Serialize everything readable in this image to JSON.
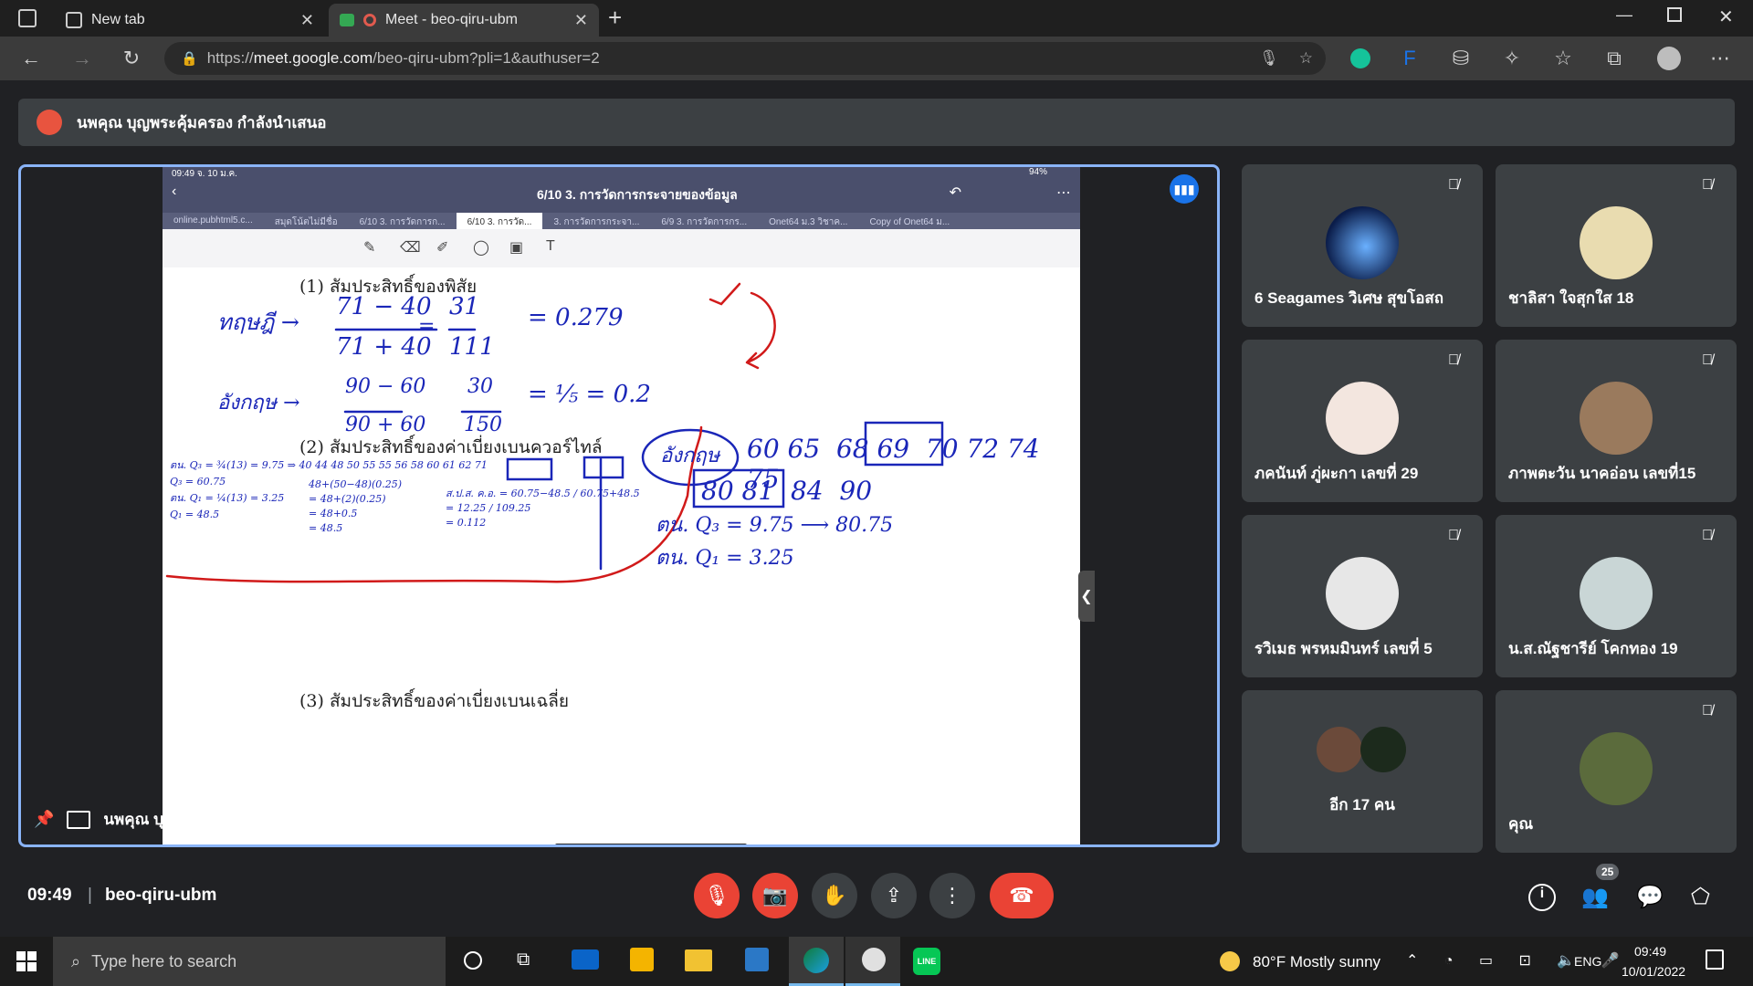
{
  "browser": {
    "tabs": [
      {
        "label": "New tab"
      },
      {
        "label": "Meet - beo-qiru-ubm"
      }
    ],
    "url_prefix": "https://",
    "url_host": "meet.google.com",
    "url_path": "/beo-qiru-ubm?pli=1&authuser=2"
  },
  "meet": {
    "banner": "นพคุณ บุญพระคุ้มครอง กำลังนำเสนอ",
    "presenter_label": "นพคุณ บุญพระคุ้มครอง",
    "time": "09:49",
    "code": "beo-qiru-ubm",
    "people_count": "25"
  },
  "slide": {
    "status_left": "09:49  จ. 10 ม.ค.",
    "status_right": "94%",
    "title": "6/10 3. การวัดการกระจายของข้อมูล",
    "tabs": [
      "online.pubhtml5.c...",
      "สมุดโน้ตไม่มีชื่อ",
      "6/10 3. การวัดการก...",
      "6/10 3. การวัด...",
      "3. การวัดการกระจา...",
      "6/9 3. การวัดการกร...",
      "Onet64 ม.3 วิชาค...",
      "Copy of Onet64 ม..."
    ],
    "q1": "(1)   สัมประสิทธิ์ของพิสัย",
    "q2": "(2)   สัมประสิทธิ์ของค่าเบี่ยงเบนควอร์ไทล์",
    "q3": "(3)   สัมประสิทธิ์ของค่าเบี่ยงเบนเฉลี่ย"
  },
  "participants": [
    {
      "name": "6 Seagames วิเศษ สุขโอสถ"
    },
    {
      "name": "ชาลิสา ใจสุกใส 18"
    },
    {
      "name": "ภคนันท์ ภู่ผะกา เลขที่ 29"
    },
    {
      "name": "ภาพตะวัน นาคอ่อน เลขที่15"
    },
    {
      "name": "รวิเมธ พรหมมินทร์ เลขที่ 5"
    },
    {
      "name": "น.ส.ณัฐชารีย์ โคกทอง 19"
    },
    {
      "name": "อีก 17 คน"
    },
    {
      "name": "คุณ"
    }
  ],
  "taskbar": {
    "search_placeholder": "Type here to search",
    "weather": "80°F  Mostly sunny",
    "lang": "ENG",
    "clock_time": "09:49",
    "clock_date": "10/01/2022"
  },
  "colors": {
    "accent": "#8ab4f8",
    "danger": "#ea4335",
    "ink": "#1a26b8"
  }
}
